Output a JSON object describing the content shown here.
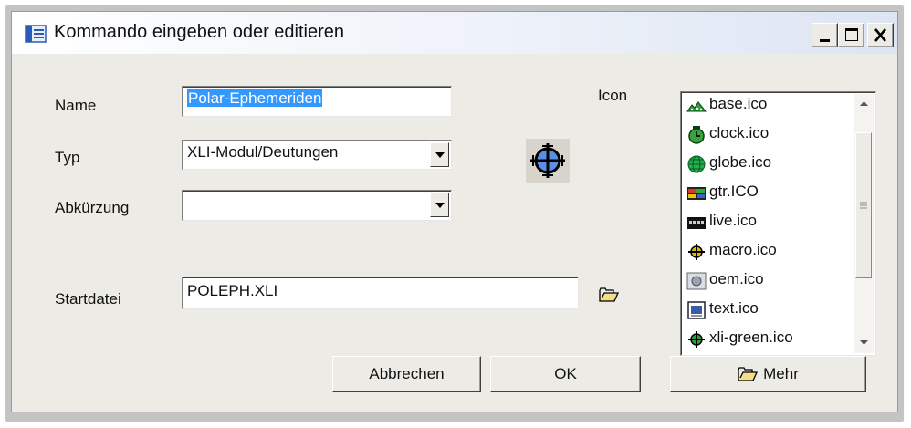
{
  "window": {
    "title": "Kommando eingeben oder editieren"
  },
  "form": {
    "name_label": "Name",
    "name_value": "Polar-Ephemeriden",
    "typ_label": "Typ",
    "typ_value": "XLI-Modul/Deutungen",
    "abk_label": "Abkürzung",
    "abk_value": "",
    "start_label": "Startdatei",
    "start_value": "POLEPH.XLI",
    "icon_label": "Icon"
  },
  "icon_list": {
    "items": [
      {
        "label": "base.ico",
        "icon": "base-icon"
      },
      {
        "label": "clock.ico",
        "icon": "clock-icon"
      },
      {
        "label": "globe.ico",
        "icon": "globe-icon"
      },
      {
        "label": "gtr.ICO",
        "icon": "gtr-icon"
      },
      {
        "label": "live.ico",
        "icon": "live-icon"
      },
      {
        "label": "macro.ico",
        "icon": "macro-icon"
      },
      {
        "label": "oem.ico",
        "icon": "oem-icon"
      },
      {
        "label": "text.ico",
        "icon": "text-icon"
      },
      {
        "label": "xli-green.ico",
        "icon": "xli-green-icon"
      }
    ]
  },
  "buttons": {
    "cancel": "Abbrechen",
    "ok": "OK",
    "more": "Mehr"
  },
  "colors": {
    "selection": "#3399ff",
    "crosshair": "#5b8fe6"
  }
}
